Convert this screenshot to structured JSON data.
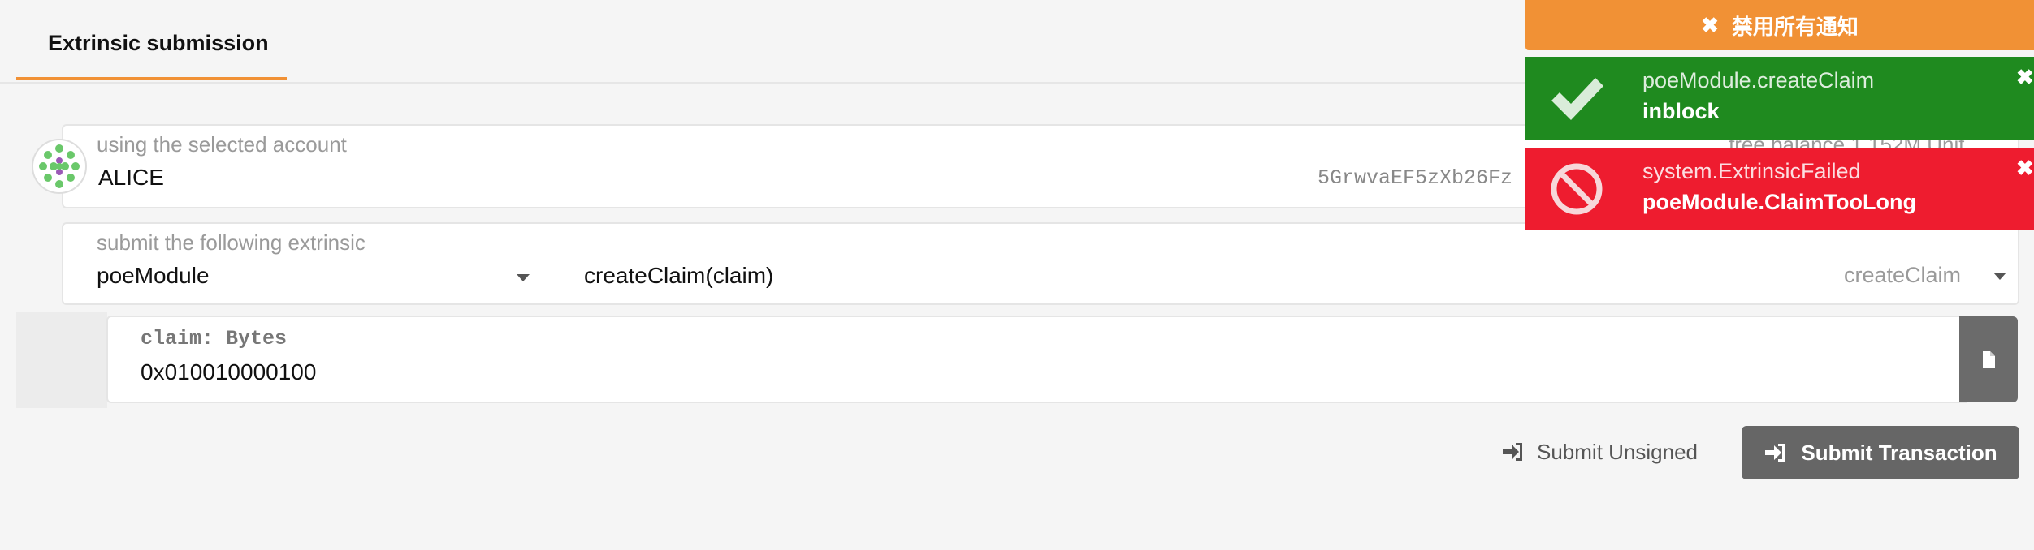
{
  "tabs": {
    "active": "Extrinsic submission"
  },
  "account": {
    "label": "using the selected account",
    "name": "ALICE",
    "address": "5GrwvaEF5zXb26Fz",
    "balance_label": "free balance 1.152M Unit"
  },
  "extrinsic": {
    "label": "submit the following extrinsic",
    "module": "poeModule",
    "call": "createClaim(claim)",
    "method": "createClaim"
  },
  "param": {
    "label": "claim: Bytes",
    "value": "0x010010000100"
  },
  "actions": {
    "unsigned": "Submit Unsigned",
    "submit": "Submit Transaction"
  },
  "notifications": {
    "dismiss_all": "禁用所有通知",
    "items": [
      {
        "title": "poeModule.createClaim",
        "status": "inblock",
        "color": "#1f8a1f",
        "icon": "check-icon"
      },
      {
        "title": "system.ExtrinsicFailed",
        "status": "poeModule.ClaimTooLong",
        "color": "#ee1c2f",
        "icon": "blocked-icon"
      }
    ]
  }
}
